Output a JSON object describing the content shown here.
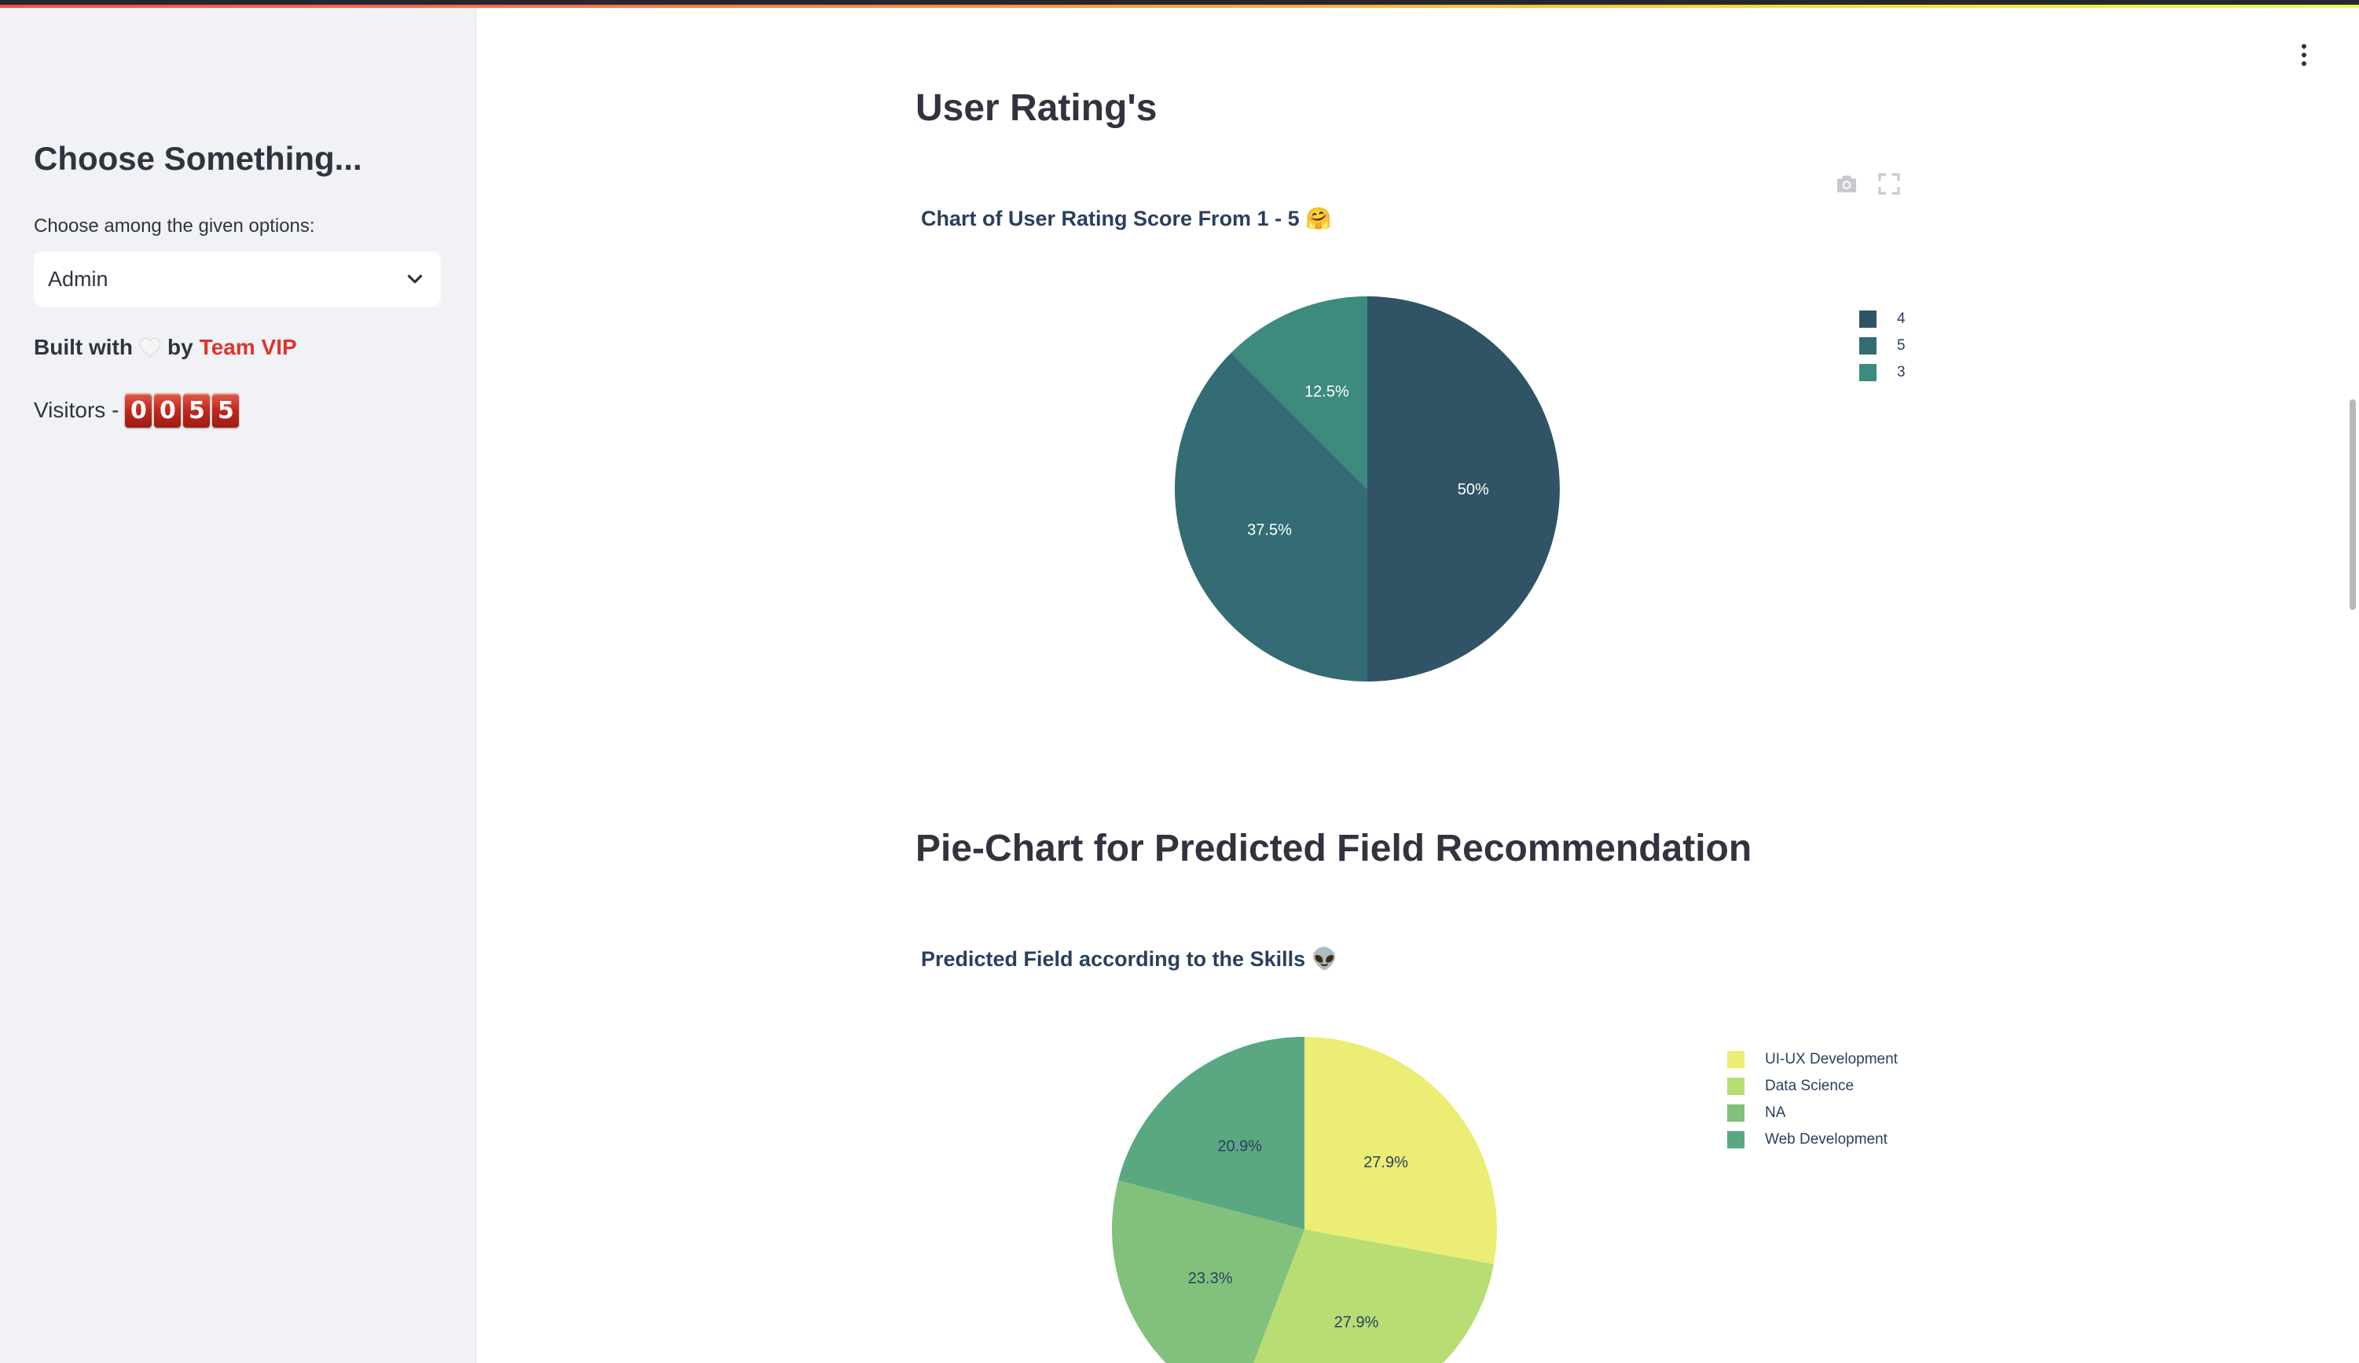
{
  "sidebar": {
    "title": "Choose Something...",
    "select_label": "Choose among the given options:",
    "select_value": "Admin",
    "built_prefix": "Built with",
    "built_by": "by",
    "team": "Team VIP",
    "visitors_label": "Visitors -",
    "visitor_digits": [
      "0",
      "0",
      "5",
      "5"
    ]
  },
  "main": {
    "section1_heading": "User Rating's",
    "section2_heading": "Pie-Chart for Predicted Field Recommendation"
  },
  "colors": {
    "accent_red": "#e0342b",
    "sidebar_bg": "#f0f2f6"
  },
  "chart_data": [
    {
      "type": "pie",
      "title": "Chart of User Rating Score From 1 - 5 🤗",
      "categories": [
        "4",
        "5",
        "3"
      ],
      "values": [
        50,
        37.5,
        12.5
      ],
      "labels": [
        "50%",
        "37.5%",
        "12.5%"
      ],
      "colors": [
        "#305466",
        "#336c74",
        "#3d8a7f"
      ],
      "legend": "top-right"
    },
    {
      "type": "pie",
      "title": "Predicted Field according to the Skills 👽",
      "categories": [
        "UI-UX Development",
        "Data Science",
        "NA",
        "Web Development"
      ],
      "values": [
        27.9,
        27.9,
        23.3,
        20.9
      ],
      "labels": [
        "27.9%",
        "27.9%",
        "23.3%",
        "20.9%"
      ],
      "colors": [
        "#ebed74",
        "#b7dd73",
        "#82c17c",
        "#5aa882"
      ],
      "legend": "top-right"
    }
  ]
}
